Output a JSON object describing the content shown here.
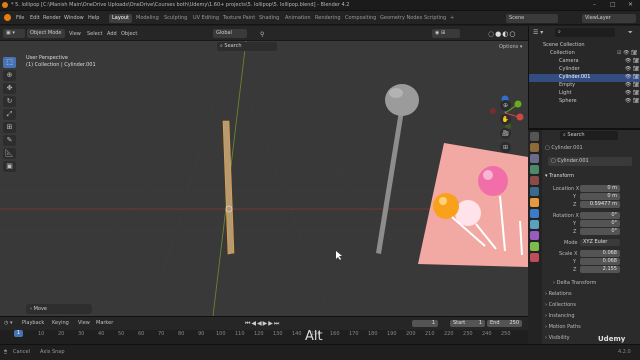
{
  "title_bar": {
    "text": "* 5. lollipop [C:\\Manish Main\\OneDrive Uploads\\OneDrive\\Courses both\\Udemy\\1.60+ projects\\5. lollipop\\5. lollipop.blend] - Blender 4.2"
  },
  "menu": [
    "File",
    "Edit",
    "Render",
    "Window",
    "Help"
  ],
  "workspaces": [
    {
      "label": "Layout",
      "active": true
    },
    {
      "label": "Modeling"
    },
    {
      "label": "Sculpting"
    },
    {
      "label": "UV Editing"
    },
    {
      "label": "Texture Paint"
    },
    {
      "label": "Shading"
    },
    {
      "label": "Animation"
    },
    {
      "label": "Rendering"
    },
    {
      "label": "Compositing"
    },
    {
      "label": "Geometry Nodes"
    },
    {
      "label": "Scripting"
    }
  ],
  "scene": {
    "label": "Scene",
    "view_layer": "ViewLayer"
  },
  "viewport_header": {
    "mode": "Object Mode",
    "menus": [
      "View",
      "Select",
      "Add",
      "Object"
    ],
    "transform": "Global",
    "search_placeholder": "Search",
    "options": "Options"
  },
  "viewport_overlay": {
    "view": "User Perspective",
    "collection": "(1) Collection | Cylinder.001",
    "move_panel": "Move"
  },
  "outliner": {
    "root": "Scene Collection",
    "collection": "Collection",
    "items": [
      {
        "label": "Camera",
        "selected": false
      },
      {
        "label": "Cylinder",
        "selected": false
      },
      {
        "label": "Cylinder.001",
        "selected": true
      },
      {
        "label": "Empty",
        "selected": false
      },
      {
        "label": "Light",
        "selected": false
      },
      {
        "label": "Sphere",
        "selected": false
      }
    ]
  },
  "properties": {
    "header": "Cylinder.001",
    "object_name": "Cylinder.001",
    "search_placeholder": "Search",
    "transform_label": "Transform",
    "location": {
      "label": "Location X",
      "x": "0 m",
      "y": "0 m",
      "z": "0.59477 m"
    },
    "rotation": {
      "label": "Rotation X",
      "x": "0°",
      "y": "0°",
      "z": "0°"
    },
    "mode": {
      "label": "Mode",
      "value": "XYZ Euler"
    },
    "scale": {
      "label": "Scale X",
      "x": "0.068",
      "y": "0.068",
      "z": "2.155"
    },
    "axis": {
      "y": "Y",
      "z": "Z"
    },
    "sections": [
      "Delta Transform",
      "Relations",
      "Collections",
      "Instancing",
      "Motion Paths",
      "Visibility"
    ]
  },
  "timeline": {
    "menus": [
      "Playback",
      "Keying",
      "View",
      "Marker"
    ],
    "current_frame": "1",
    "start_label": "Start",
    "start": "1",
    "end_label": "End",
    "end": "250",
    "ticks": [
      "1",
      "10",
      "20",
      "30",
      "40",
      "50",
      "60",
      "70",
      "80",
      "90",
      "100",
      "110",
      "120",
      "130",
      "140",
      "150",
      "160",
      "170",
      "180",
      "190",
      "200",
      "210",
      "220",
      "230",
      "240",
      "250"
    ]
  },
  "status_bar": {
    "left": "Cancel",
    "middle": "Axis Snap",
    "overlay_key": "Alt",
    "watermark": "Udemy",
    "version": "4.2.0"
  },
  "colors": {
    "accent": "#4772b3",
    "selected_row": "#334d80",
    "grid": "#3d3d3d",
    "x_axis": "#8a3838",
    "y_axis": "#6e8e2e"
  }
}
